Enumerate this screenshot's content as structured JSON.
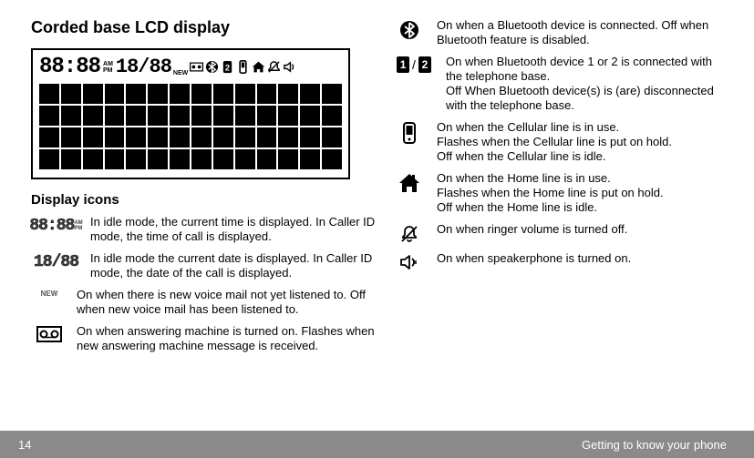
{
  "title": "Corded base LCD display",
  "subtitle": "Display icons",
  "lcd": {
    "time": "88:88",
    "am": "AM",
    "pm": "PM",
    "date": "18/88",
    "new": "NEW"
  },
  "left_icons": {
    "time": {
      "desc": "In idle mode, the current time is displayed. In Caller ID mode, the time of call is displayed."
    },
    "date": {
      "desc": "In idle mode the current date is displayed. In Caller ID mode, the date of the call is displayed."
    },
    "new": {
      "label": "NEW",
      "desc": "On when there is new voice mail not yet listened to. Off when new voice mail has been listened to."
    },
    "tape": {
      "desc": "On when answering machine is turned on. Flashes when new answering machine message is received."
    }
  },
  "right_icons": {
    "bluetooth": {
      "desc": "On when a Bluetooth device is connected. Off when Bluetooth feature is disabled."
    },
    "badges": {
      "b1": "1",
      "b2": "2",
      "slash": "/",
      "desc": "On when Bluetooth device 1 or 2 is connected with the telephone base.\nOff When Bluetooth device(s) is (are) disconnected with the telephone base."
    },
    "cell": {
      "desc": "On when the Cellular line is in use.\nFlashes when the Cellular line is put on hold.\nOff when the Cellular line is idle."
    },
    "home": {
      "desc": "On when the Home line is in use.\nFlashes when the Home line is put on hold.\nOff when the Home line is idle."
    },
    "ringer_off": {
      "desc": "On when ringer volume is turned off."
    },
    "speaker": {
      "desc": "On when speakerphone is turned on."
    }
  },
  "footer": {
    "page": "14",
    "section": "Getting to know your phone"
  }
}
